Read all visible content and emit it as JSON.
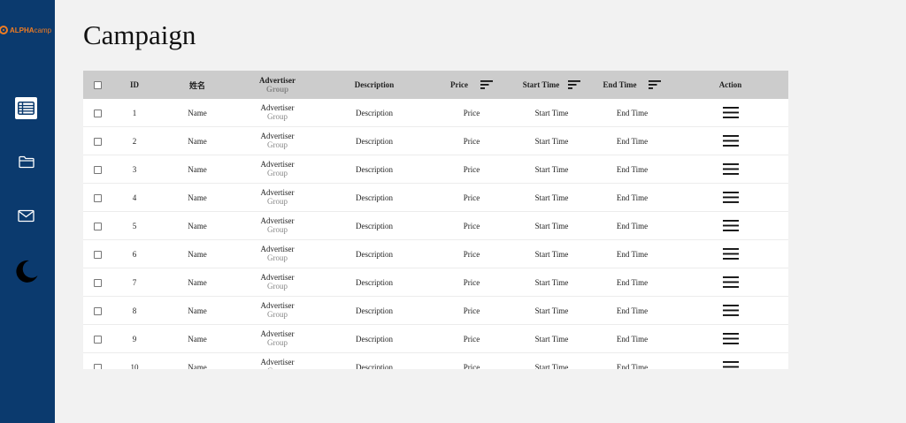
{
  "sidebar": {
    "logo": {
      "brand_bold": "ALPHA",
      "brand_light": "camp"
    },
    "nav": [
      {
        "name": "list-view",
        "icon": "table-list-icon",
        "active": true
      },
      {
        "name": "folder",
        "icon": "folder-icon",
        "active": false
      },
      {
        "name": "mail",
        "icon": "mail-icon",
        "active": false
      },
      {
        "name": "dark-mode",
        "icon": "moon-icon",
        "active": false
      }
    ]
  },
  "page": {
    "title": "Campaign"
  },
  "table": {
    "headers": {
      "id": "ID",
      "name": "姓名",
      "advertiser": "Advertiser",
      "advertiser_sub": "Group",
      "description": "Description",
      "price": "Price",
      "start_time": "Start Time",
      "end_time": "End Time",
      "action": "Action"
    },
    "rows": [
      {
        "id": "1",
        "name": "Name",
        "advertiser": "Advertiser",
        "group": "Group",
        "description": "Description",
        "price": "Price",
        "start_time": "Start Time",
        "end_time": "End Time"
      },
      {
        "id": "2",
        "name": "Name",
        "advertiser": "Advertiser",
        "group": "Group",
        "description": "Description",
        "price": "Price",
        "start_time": "Start Time",
        "end_time": "End Time"
      },
      {
        "id": "3",
        "name": "Name",
        "advertiser": "Advertiser",
        "group": "Group",
        "description": "Description",
        "price": "Price",
        "start_time": "Start Time",
        "end_time": "End Time"
      },
      {
        "id": "4",
        "name": "Name",
        "advertiser": "Advertiser",
        "group": "Group",
        "description": "Description",
        "price": "Price",
        "start_time": "Start Time",
        "end_time": "End Time"
      },
      {
        "id": "5",
        "name": "Name",
        "advertiser": "Advertiser",
        "group": "Group",
        "description": "Description",
        "price": "Price",
        "start_time": "Start Time",
        "end_time": "End Time"
      },
      {
        "id": "6",
        "name": "Name",
        "advertiser": "Advertiser",
        "group": "Group",
        "description": "Description",
        "price": "Price",
        "start_time": "Start Time",
        "end_time": "End Time"
      },
      {
        "id": "7",
        "name": "Name",
        "advertiser": "Advertiser",
        "group": "Group",
        "description": "Description",
        "price": "Price",
        "start_time": "Start Time",
        "end_time": "End Time"
      },
      {
        "id": "8",
        "name": "Name",
        "advertiser": "Advertiser",
        "group": "Group",
        "description": "Description",
        "price": "Price",
        "start_time": "Start Time",
        "end_time": "End Time"
      },
      {
        "id": "9",
        "name": "Name",
        "advertiser": "Advertiser",
        "group": "Group",
        "description": "Description",
        "price": "Price",
        "start_time": "Start Time",
        "end_time": "End Time"
      },
      {
        "id": "10",
        "name": "Name",
        "advertiser": "Advertiser",
        "group": "Group",
        "description": "Description",
        "price": "Price",
        "start_time": "Start Time",
        "end_time": "End Time"
      }
    ]
  },
  "colors": {
    "sidebar_bg": "#0b3a6e",
    "brand_accent": "#f07c22",
    "header_bg": "#cccccc",
    "page_bg": "#f2f2f2"
  }
}
